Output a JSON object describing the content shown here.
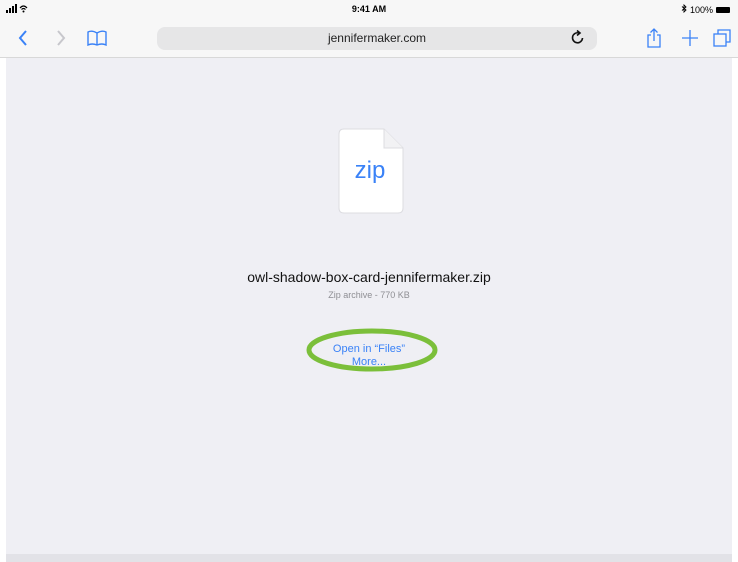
{
  "status_bar": {
    "time": "9:41 AM",
    "battery": "100%",
    "signal_icon": "signal-wifi-icon",
    "bluetooth_icon": "bluetooth-icon"
  },
  "toolbar": {
    "url": "jennifermaker.com",
    "icons": [
      "back-icon",
      "forward-icon",
      "bookmarks-icon",
      "reload-icon",
      "share-icon",
      "new-tab-icon",
      "tabs-icon"
    ]
  },
  "download": {
    "file_type": "zip",
    "file_name": "owl-shadow-box-card-jennifermaker.zip",
    "meta": "Zip archive - 770 KB",
    "open_label": "Open in “Files”",
    "more_label": "More..."
  },
  "colors": {
    "accent": "#3a82f7",
    "highlight": "#7bbf3a",
    "background": "#efeff4"
  }
}
